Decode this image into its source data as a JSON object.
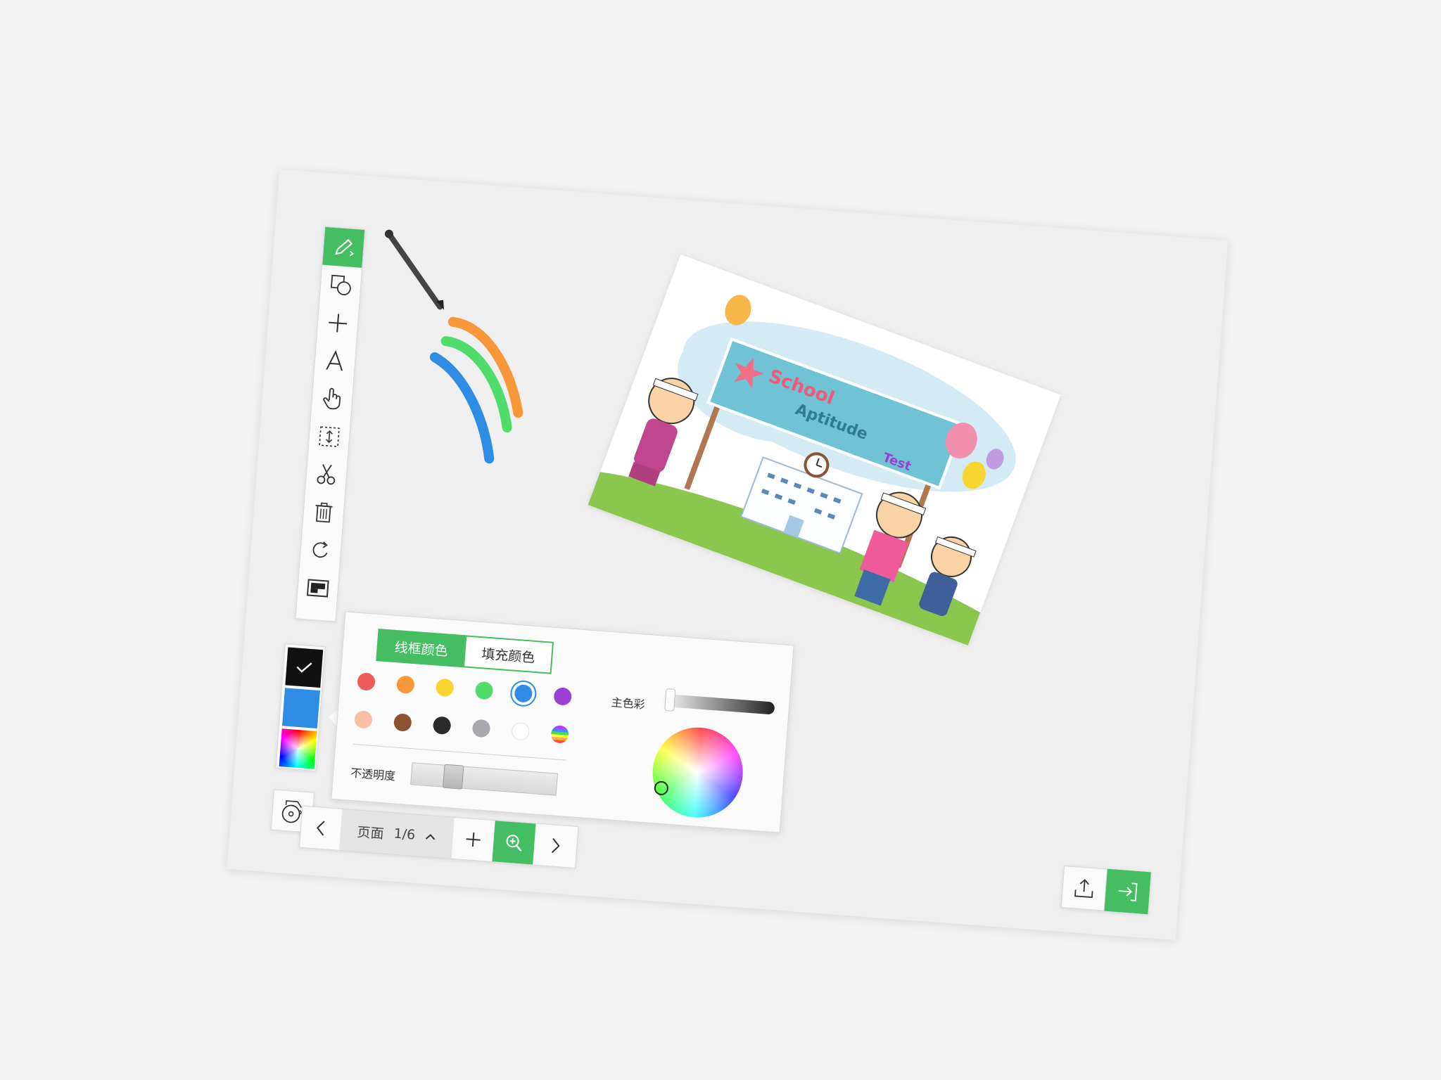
{
  "color_panel": {
    "tab_stroke": "线框颜色",
    "tab_fill": "填充颜色",
    "opacity_label": "不透明度",
    "main_color_label": "主色彩",
    "opacity_value": 0.25,
    "brightness_value": 0.05,
    "palette_row1": [
      "#ef5a5a",
      "#f7973a",
      "#f9d532",
      "#4fdc6a",
      "#2e8ce4",
      "#9a3fd3"
    ],
    "palette_row2": [
      "#f9bea6",
      "#8a5334",
      "#2b2b2b",
      "#a7a7ad",
      "#ffffff",
      "rainbow"
    ],
    "selected_color": "#2e8ce4"
  },
  "swatches": {
    "stroke": "#111111",
    "fill": "#2e8ce4"
  },
  "pager": {
    "page_label": "页面",
    "page_indicator": "1/6"
  },
  "picture": {
    "sign_line1": "School",
    "sign_line2": "Aptitude",
    "sign_line3": "Test"
  },
  "ink_strokes": [
    {
      "color": "#f7973a"
    },
    {
      "color": "#4fdc6a"
    },
    {
      "color": "#2e8ce4"
    }
  ],
  "icons": {
    "pencil": "pencil-icon",
    "shapes": "shapes-icon",
    "line": "line-icon",
    "text": "text-icon",
    "hand": "hand-pointer-icon",
    "select": "select-icon",
    "scissors": "scissors-icon",
    "trash": "trash-icon",
    "redo": "redo-icon",
    "background": "background-icon",
    "record": "record-icon",
    "export": "export-icon",
    "exit": "exit-icon",
    "zoom": "zoom-in-icon"
  },
  "accent_color": "#45bd62"
}
